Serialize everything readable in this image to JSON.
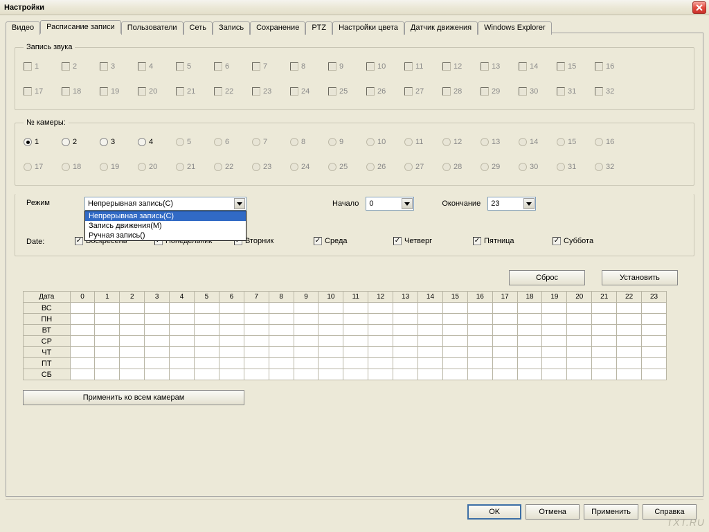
{
  "title": "Настройки",
  "tabs": [
    "Видео",
    "Расписание записи",
    "Пользователи",
    "Сеть",
    "Запись",
    "Сохранение",
    "PTZ",
    "Настройки цвета",
    "Датчик движения",
    "Windows Explorer"
  ],
  "active_tab_index": 1,
  "sound_group": "Запись звука",
  "camera_group": "№ камеры:",
  "numbers_1_16": [
    "1",
    "2",
    "3",
    "4",
    "5",
    "6",
    "7",
    "8",
    "9",
    "10",
    "11",
    "12",
    "13",
    "14",
    "15",
    "16"
  ],
  "numbers_17_32": [
    "17",
    "18",
    "19",
    "20",
    "21",
    "22",
    "23",
    "24",
    "25",
    "26",
    "27",
    "28",
    "29",
    "30",
    "31",
    "32"
  ],
  "camera_enabled": [
    true,
    true,
    true,
    true,
    false,
    false,
    false,
    false,
    false,
    false,
    false,
    false,
    false,
    false,
    false,
    false,
    false,
    false,
    false,
    false,
    false,
    false,
    false,
    false,
    false,
    false,
    false,
    false,
    false,
    false,
    false,
    false
  ],
  "camera_selected_index": 0,
  "mode_label": "Режим",
  "mode_value": "Непрерывная запись(C)",
  "mode_options": [
    "Непрерывная запись(C)",
    "Запись движения(M)",
    "Ручная запись()"
  ],
  "start_label": "Начало",
  "start_value": "0",
  "end_label": "Окончание",
  "end_value": "23",
  "date_label": "Date:",
  "days": [
    "Воскресень",
    "Понедельник",
    "Вторник",
    "Среда",
    "Четверг",
    "Пятница",
    "Суббота"
  ],
  "days_checked": [
    true,
    true,
    true,
    true,
    true,
    true,
    true
  ],
  "reset_btn": "Сброс",
  "set_btn": "Установить",
  "schedule_header_first": "Дата",
  "schedule_hours": [
    "0",
    "1",
    "2",
    "3",
    "4",
    "5",
    "6",
    "7",
    "8",
    "9",
    "10",
    "11",
    "12",
    "13",
    "14",
    "15",
    "16",
    "17",
    "18",
    "19",
    "20",
    "21",
    "22",
    "23"
  ],
  "schedule_rows": [
    "ВС",
    "ПН",
    "ВТ",
    "СР",
    "ЧТ",
    "ПТ",
    "СБ"
  ],
  "apply_all_btn": "Применить ко всем камерам",
  "ok_btn": "OK",
  "cancel_btn": "Отмена",
  "apply_btn": "Применить",
  "help_btn": "Справка",
  "watermark": "TXT.RU"
}
